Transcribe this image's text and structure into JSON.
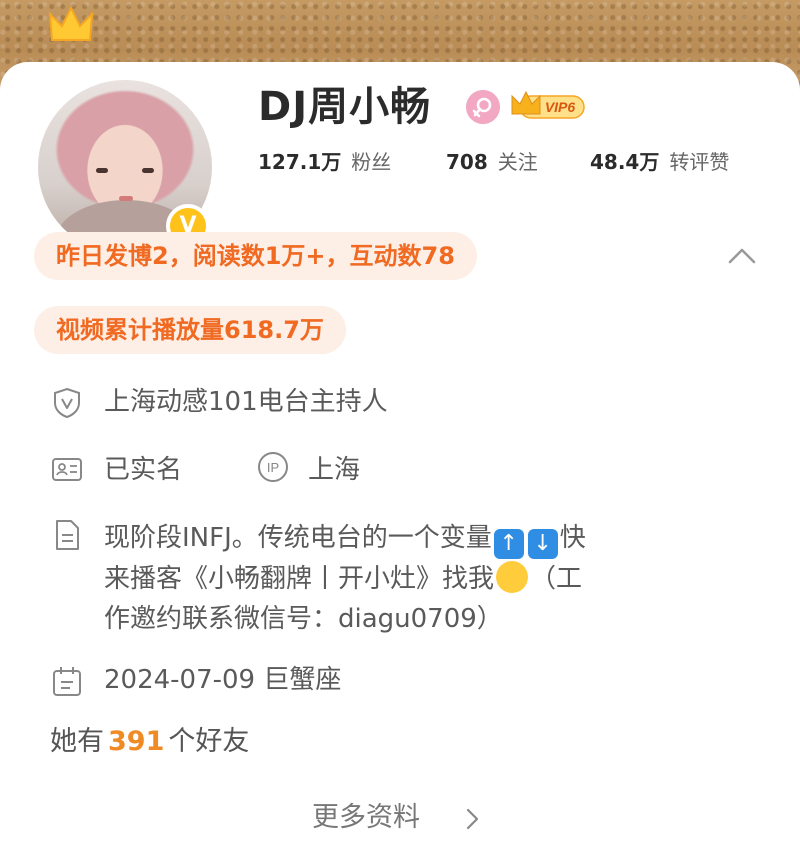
{
  "profile": {
    "name": "DJ周小畅",
    "verified_badge": "V",
    "vip_label": "VIP6",
    "stats": [
      {
        "value": "127.1万",
        "label": "粉丝"
      },
      {
        "value": "708",
        "label": "关注"
      },
      {
        "value": "48.4万",
        "label": "转评赞"
      }
    ]
  },
  "highlights": {
    "activity": "昨日发博2，阅读数1万+，互动数78",
    "video_plays": "视频累计播放量618.7万"
  },
  "info": {
    "verification": "上海动感101电台主持人",
    "realname": "已实名",
    "ip_location": "上海",
    "bio_line1_a": "现阶段INFJ。传统电台的一个变量",
    "bio_line1_b": "快",
    "bio_line2_a": "来播客《小畅翻牌丨开小灶》找我",
    "bio_line2_b": "（工",
    "bio_line3": "作邀约联系微信号：diagu0709）",
    "birthday": "2024-07-09 巨蟹座"
  },
  "friends": {
    "prefix": "她有",
    "count": "391",
    "suffix": "个好友"
  },
  "more_label": "更多资料",
  "colors": {
    "accent_orange": "#f06a22",
    "pill_bg": "#fdeee6",
    "vip_gold": "#f5a623",
    "gender_pink": "#f2a7c3",
    "verified_yellow": "#ffc21a"
  },
  "icons": [
    "crown-icon",
    "verified-v-icon",
    "female-icon",
    "vip-badge-icon",
    "chevron-up-icon",
    "shield-v-icon",
    "id-card-icon",
    "ip-icon",
    "document-icon",
    "up-arrow-emoji",
    "down-arrow-emoji",
    "hug-emoji",
    "calendar-icon",
    "chevron-right-icon"
  ]
}
